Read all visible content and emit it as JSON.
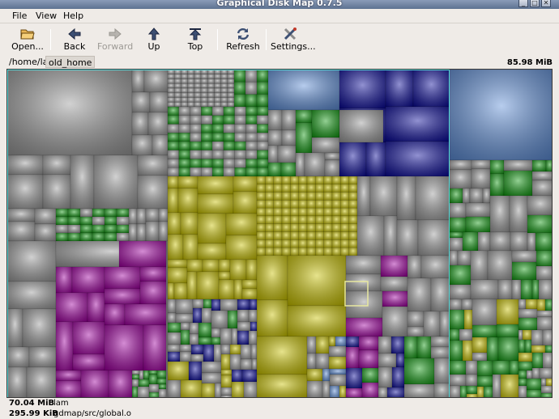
{
  "window": {
    "title": "Graphical Disk Map 0.7.5",
    "buttons": [
      "_",
      "□",
      "✕"
    ]
  },
  "menu": [
    "File",
    "View",
    "Help"
  ],
  "toolbar": {
    "open": "Open...",
    "back": "Back",
    "forward": "Forward",
    "up": "Up",
    "top": "Top",
    "refresh": "Refresh",
    "settings": "Settings..."
  },
  "breadcrumb": [
    "/home/lam",
    "old_home"
  ],
  "total_size": "85.98 MiB",
  "colors": {
    "gray": "#9a9a9a",
    "green": "#139b13",
    "blue": "#0c0c9a",
    "yellow": "#c9c200",
    "magenta": "#a000a0",
    "lightblue": "#5f8fd8",
    "selection": "#53d6d6"
  },
  "status": {
    "selected_size": "70.04 MiB",
    "selected_name": "lam",
    "hover_size": "295.99 KiB",
    "hover_path": "gdmap/src/global.o"
  }
}
